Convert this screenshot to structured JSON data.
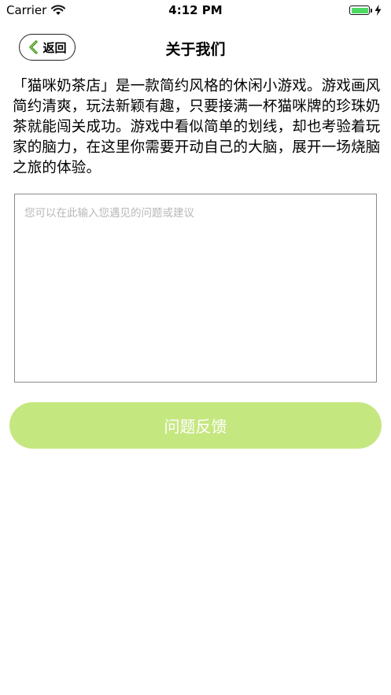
{
  "status_bar": {
    "carrier": "Carrier",
    "time": "4:12 PM",
    "battery_level": 1.0,
    "battery_color": "#4cd964"
  },
  "nav": {
    "back_label": "返回",
    "title": "关于我们"
  },
  "intro": {
    "text": "「猫咪奶茶店」是一款简约风格的休闲小游戏。游戏画风简约清爽，玩法新颖有趣，只要接满一杯猫咪牌的珍珠奶茶就能闯关成功。游戏中看似简单的划线，却也考验着玩家的脑力，在这里你需要开动自己的大脑，展开一场烧脑之旅的体验。"
  },
  "feedback": {
    "placeholder": "您可以在此输入您遇见的问题或建议",
    "value": ""
  },
  "submit": {
    "label": "问题反馈",
    "color": "#c5e780"
  }
}
